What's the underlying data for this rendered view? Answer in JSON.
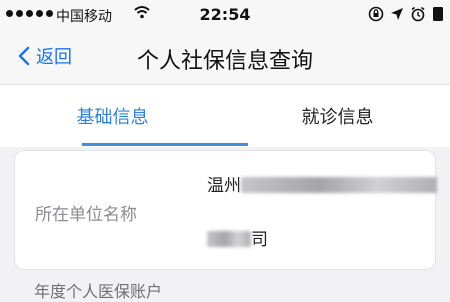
{
  "status_bar": {
    "carrier": "中国移动",
    "time": "22:54",
    "icons": [
      "signal-dots-icon",
      "wifi-icon",
      "rotation-lock-icon",
      "location-arrow-icon",
      "alarm-clock-icon"
    ]
  },
  "nav": {
    "back_label": "返回",
    "title": "个人社保信息查询",
    "accent_color": "#1a73e8"
  },
  "tabs": [
    {
      "label": "基础信息",
      "active": true
    },
    {
      "label": "就诊信息",
      "active": false
    }
  ],
  "info_card": {
    "field_label": "所在单位名称",
    "value_line1_visible": "温州",
    "value_line2_visible": "司",
    "value_partially_obscured": true
  },
  "section": {
    "next_label": "年度个人医保账户"
  }
}
